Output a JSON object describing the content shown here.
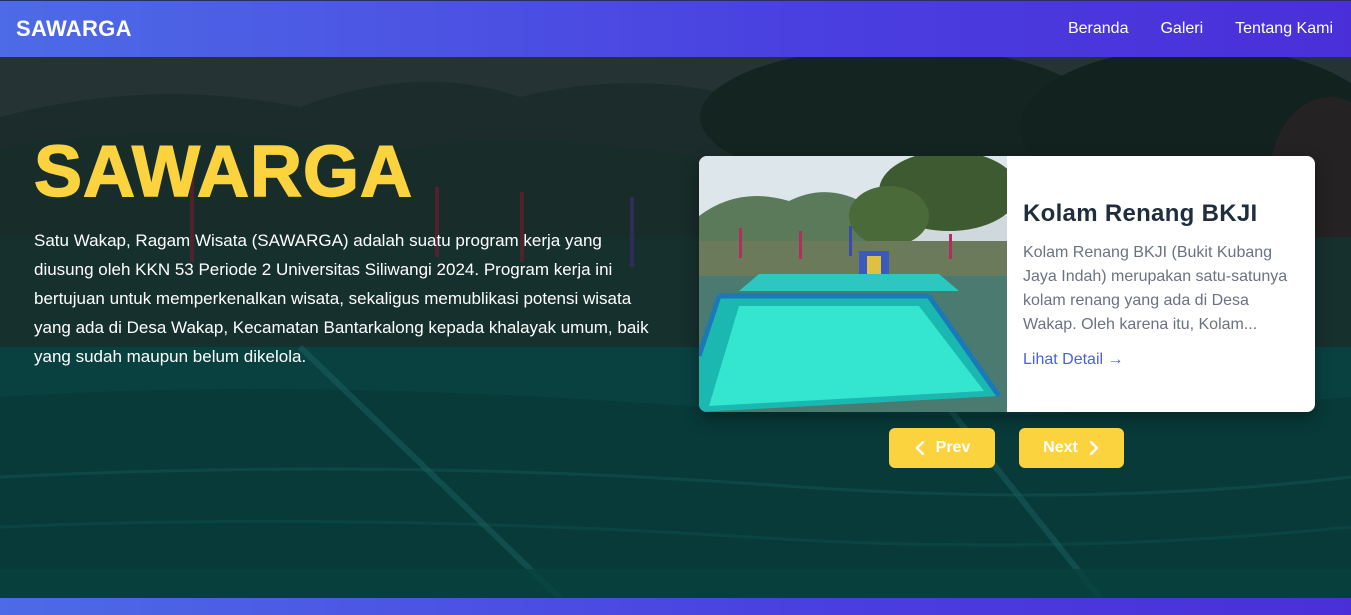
{
  "navbar": {
    "brand": "SAWARGA",
    "links": [
      {
        "label": "Beranda"
      },
      {
        "label": "Galeri"
      },
      {
        "label": "Tentang Kami"
      }
    ]
  },
  "hero": {
    "title": "SAWARGA",
    "description": "Satu Wakap, Ragam Wisata (SAWARGA) adalah suatu program kerja yang diusung oleh KKN 53 Periode 2 Universitas Siliwangi 2024. Program kerja ini bertujuan untuk memperkenalkan wisata, sekaligus memublikasi potensi wisata yang ada di Desa Wakap, Kecamatan Bantarkalong kepada khalayak umum, baik yang sudah maupun belum dikelola."
  },
  "card": {
    "title": "Kolam Renang BKJI",
    "text": "Kolam Renang BKJI (Bukit Kubang Jaya Indah) merupakan satu-satunya kolam renang yang ada di Desa Wakap. Oleh karena itu, Kolam...",
    "link_label": "Lihat Detail →",
    "image_icon": "swimming-pool-photo"
  },
  "controls": {
    "prev_label": "Prev",
    "next_label": "Next",
    "prev_icon": "chevron-left-icon",
    "next_icon": "chevron-right-icon"
  },
  "colors": {
    "accent": "#fbd33e",
    "nav_gradient_start": "#4d6be6",
    "nav_gradient_end": "#4a2fd8",
    "link": "#4a63d8"
  }
}
